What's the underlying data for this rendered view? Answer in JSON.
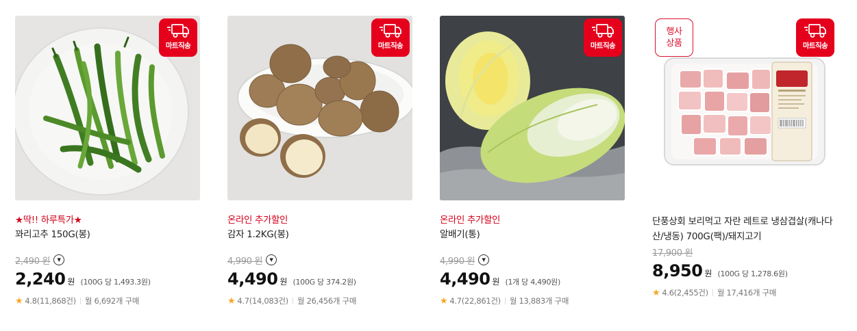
{
  "products": [
    {
      "badge_direct": "마트직송",
      "promo": "★딱!! 하루특가★",
      "title": "꽈리고추 150G(봉)",
      "original_price": "2,490 원",
      "price": "2,240",
      "currency": "원",
      "unit_price": "(100G 당 1,493.3원)",
      "rating": "4.8(11,868건)",
      "monthly": "월 6,692개 구매"
    },
    {
      "badge_direct": "마트직송",
      "promo": "온라인 추가할인",
      "title": "감자 1.2KG(봉)",
      "original_price": "4,990 원",
      "price": "4,490",
      "currency": "원",
      "unit_price": "(100G 당 374.2원)",
      "rating": "4.7(14,083건)",
      "monthly": "월 26,456개 구매"
    },
    {
      "badge_direct": "마트직송",
      "promo": "온라인 추가할인",
      "title": "알배기(통)",
      "original_price": "4,990 원",
      "price": "4,490",
      "currency": "원",
      "unit_price": "(1개 당 4,490원)",
      "rating": "4.7(22,861건)",
      "monthly": "월 13,883개 구매"
    },
    {
      "badge_direct": "마트직송",
      "badge_event_line1": "행사",
      "badge_event_line2": "상품",
      "title": "단풍상회 보리먹고 자란 레트로 냉삼겹살(캐나다산/냉동) 700G(팩)/돼지고기",
      "original_price": "17,900 원",
      "price": "8,950",
      "currency": "원",
      "unit_price": "(100G 당 1,278.6원)",
      "rating": "4.6(2,455건)",
      "monthly": "월 17,416개 구매"
    }
  ],
  "icons": {
    "truck": "delivery-truck-icon",
    "info": "chevron-down-circle-icon",
    "star": "star-icon"
  },
  "colors": {
    "badge_red": "#e5001c",
    "promo_red": "#d4001b",
    "star_yellow": "#f5a623"
  }
}
